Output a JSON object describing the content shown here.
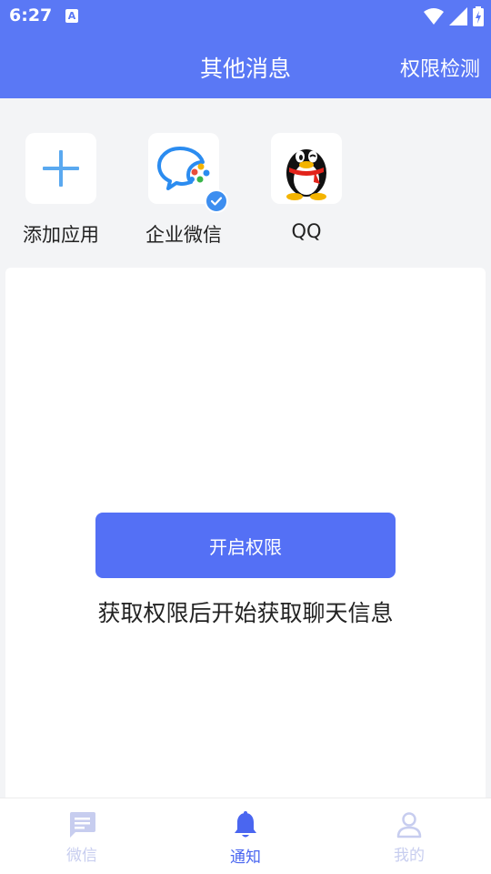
{
  "status_bar": {
    "time": "6:27",
    "notification_glyph": "A",
    "icons": [
      "wifi-icon",
      "signal-icon",
      "battery-charging-icon"
    ]
  },
  "app_bar": {
    "title": "其他消息",
    "action_label": "权限检测"
  },
  "apps": [
    {
      "label": "添加应用",
      "icon": "add-icon"
    },
    {
      "label": "企业微信",
      "icon": "wecom-icon",
      "verified": true
    },
    {
      "label": "QQ",
      "icon": "qq-penguin-icon"
    }
  ],
  "main": {
    "enable_button_label": "开启权限",
    "hint": "获取权限后开始获取聊天信息"
  },
  "tab_bar": {
    "tabs": [
      {
        "label": "微信",
        "icon": "chat-message-icon",
        "active": false
      },
      {
        "label": "通知",
        "icon": "bell-icon",
        "active": true
      },
      {
        "label": "我的",
        "icon": "person-icon",
        "active": false
      }
    ]
  },
  "colors": {
    "primary": "#5a78f5",
    "button": "#5470f5",
    "active_tab": "#4a66f0",
    "inactive_tab": "#c7cdef",
    "background": "#f3f4f6"
  }
}
